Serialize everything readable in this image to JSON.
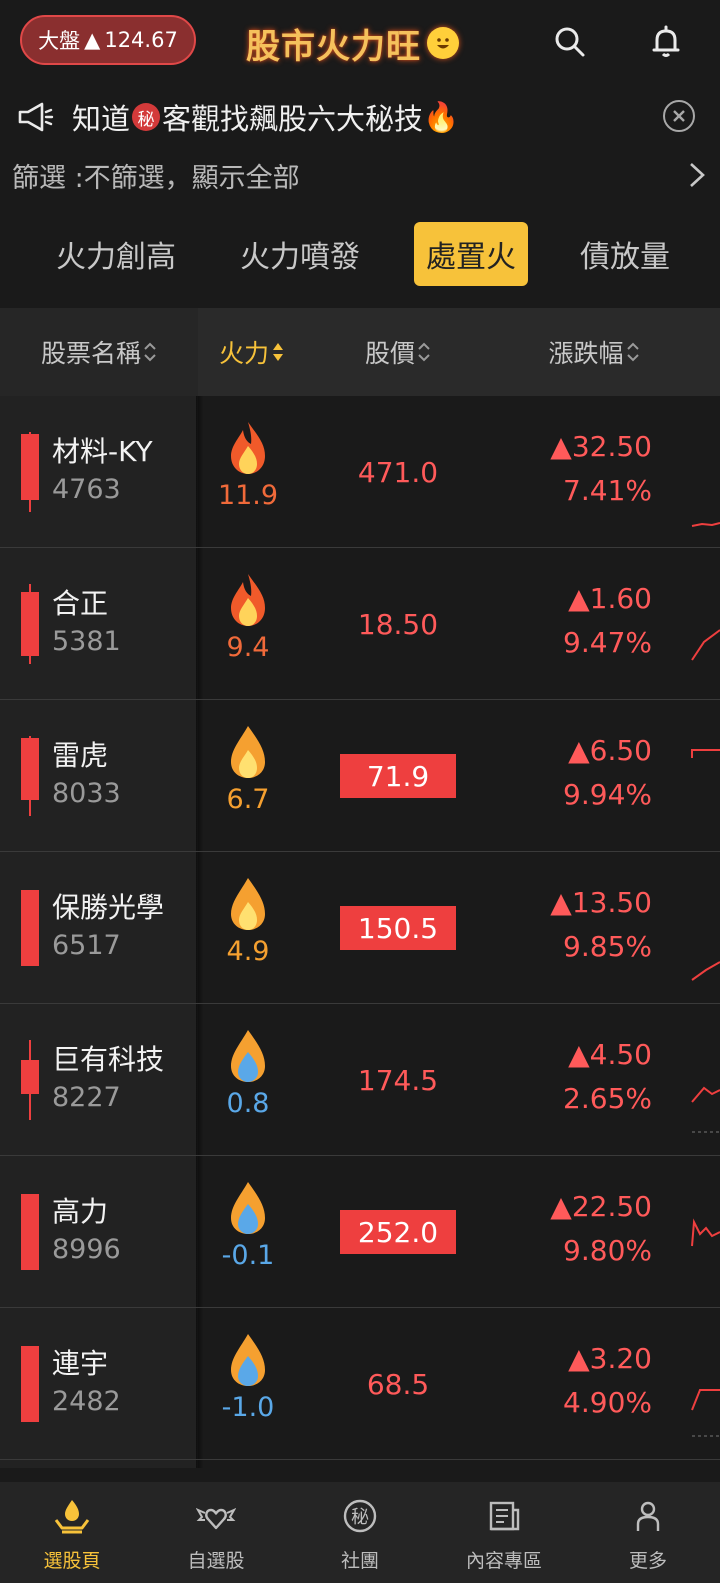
{
  "header": {
    "market_label": "大盤",
    "market_arrow": "▲",
    "market_value": "124.67",
    "app_title": "股市火力旺",
    "title_emoji": "😁"
  },
  "announcement": {
    "text_before": "知道",
    "badge": "秘",
    "text_after": "客觀找飆股六大秘技",
    "emoji": "🔥"
  },
  "filter": {
    "text": "篩選 :不篩選，顯示全部"
  },
  "tabs": [
    {
      "label": "火力創高",
      "active": false
    },
    {
      "label": "火力噴發",
      "active": false
    },
    {
      "label": "處置火",
      "active": true
    },
    {
      "label": "債放量",
      "active": false
    }
  ],
  "table": {
    "headers": {
      "name": "股票名稱",
      "fire": "火力",
      "price": "股價",
      "change": "漲跌幅"
    },
    "rows": [
      {
        "name": "材料-KY",
        "code": "4763",
        "fire": "11.9",
        "price": "471.0",
        "change": "▲32.50",
        "pct": "7.41%",
        "limit": false
      },
      {
        "name": "合正",
        "code": "5381",
        "fire": "9.4",
        "price": "18.50",
        "change": "▲1.60",
        "pct": "9.47%",
        "limit": false
      },
      {
        "name": "雷虎",
        "code": "8033",
        "fire": "6.7",
        "price": "71.9",
        "change": "▲6.50",
        "pct": "9.94%",
        "limit": true
      },
      {
        "name": "保勝光學",
        "code": "6517",
        "fire": "4.9",
        "price": "150.5",
        "change": "▲13.50",
        "pct": "9.85%",
        "limit": true
      },
      {
        "name": "巨有科技",
        "code": "8227",
        "fire": "0.8",
        "price": "174.5",
        "change": "▲4.50",
        "pct": "2.65%",
        "limit": false
      },
      {
        "name": "高力",
        "code": "8996",
        "fire": "-0.1",
        "price": "252.0",
        "change": "▲22.50",
        "pct": "9.80%",
        "limit": true
      },
      {
        "name": "連宇",
        "code": "2482",
        "fire": "-1.0",
        "price": "68.5",
        "change": "▲3.20",
        "pct": "4.90%",
        "limit": false
      }
    ]
  },
  "nav": [
    {
      "label": "選股頁",
      "icon": "hand-fire-icon",
      "active": true
    },
    {
      "label": "自選股",
      "icon": "winged-heart-icon",
      "active": false
    },
    {
      "label": "社團",
      "icon": "secret-badge-icon",
      "active": false
    },
    {
      "label": "內容專區",
      "icon": "newspaper-icon",
      "active": false
    },
    {
      "label": "更多",
      "icon": "person-icon",
      "active": false
    }
  ],
  "colors": {
    "accent": "#f7c23a",
    "up": "#ff5a5a",
    "limit_bg": "#ee3f3f",
    "hot_fire": "#f05a2a",
    "warm_fire": "#f5a030",
    "cool_fire": "#5aa8e8"
  }
}
